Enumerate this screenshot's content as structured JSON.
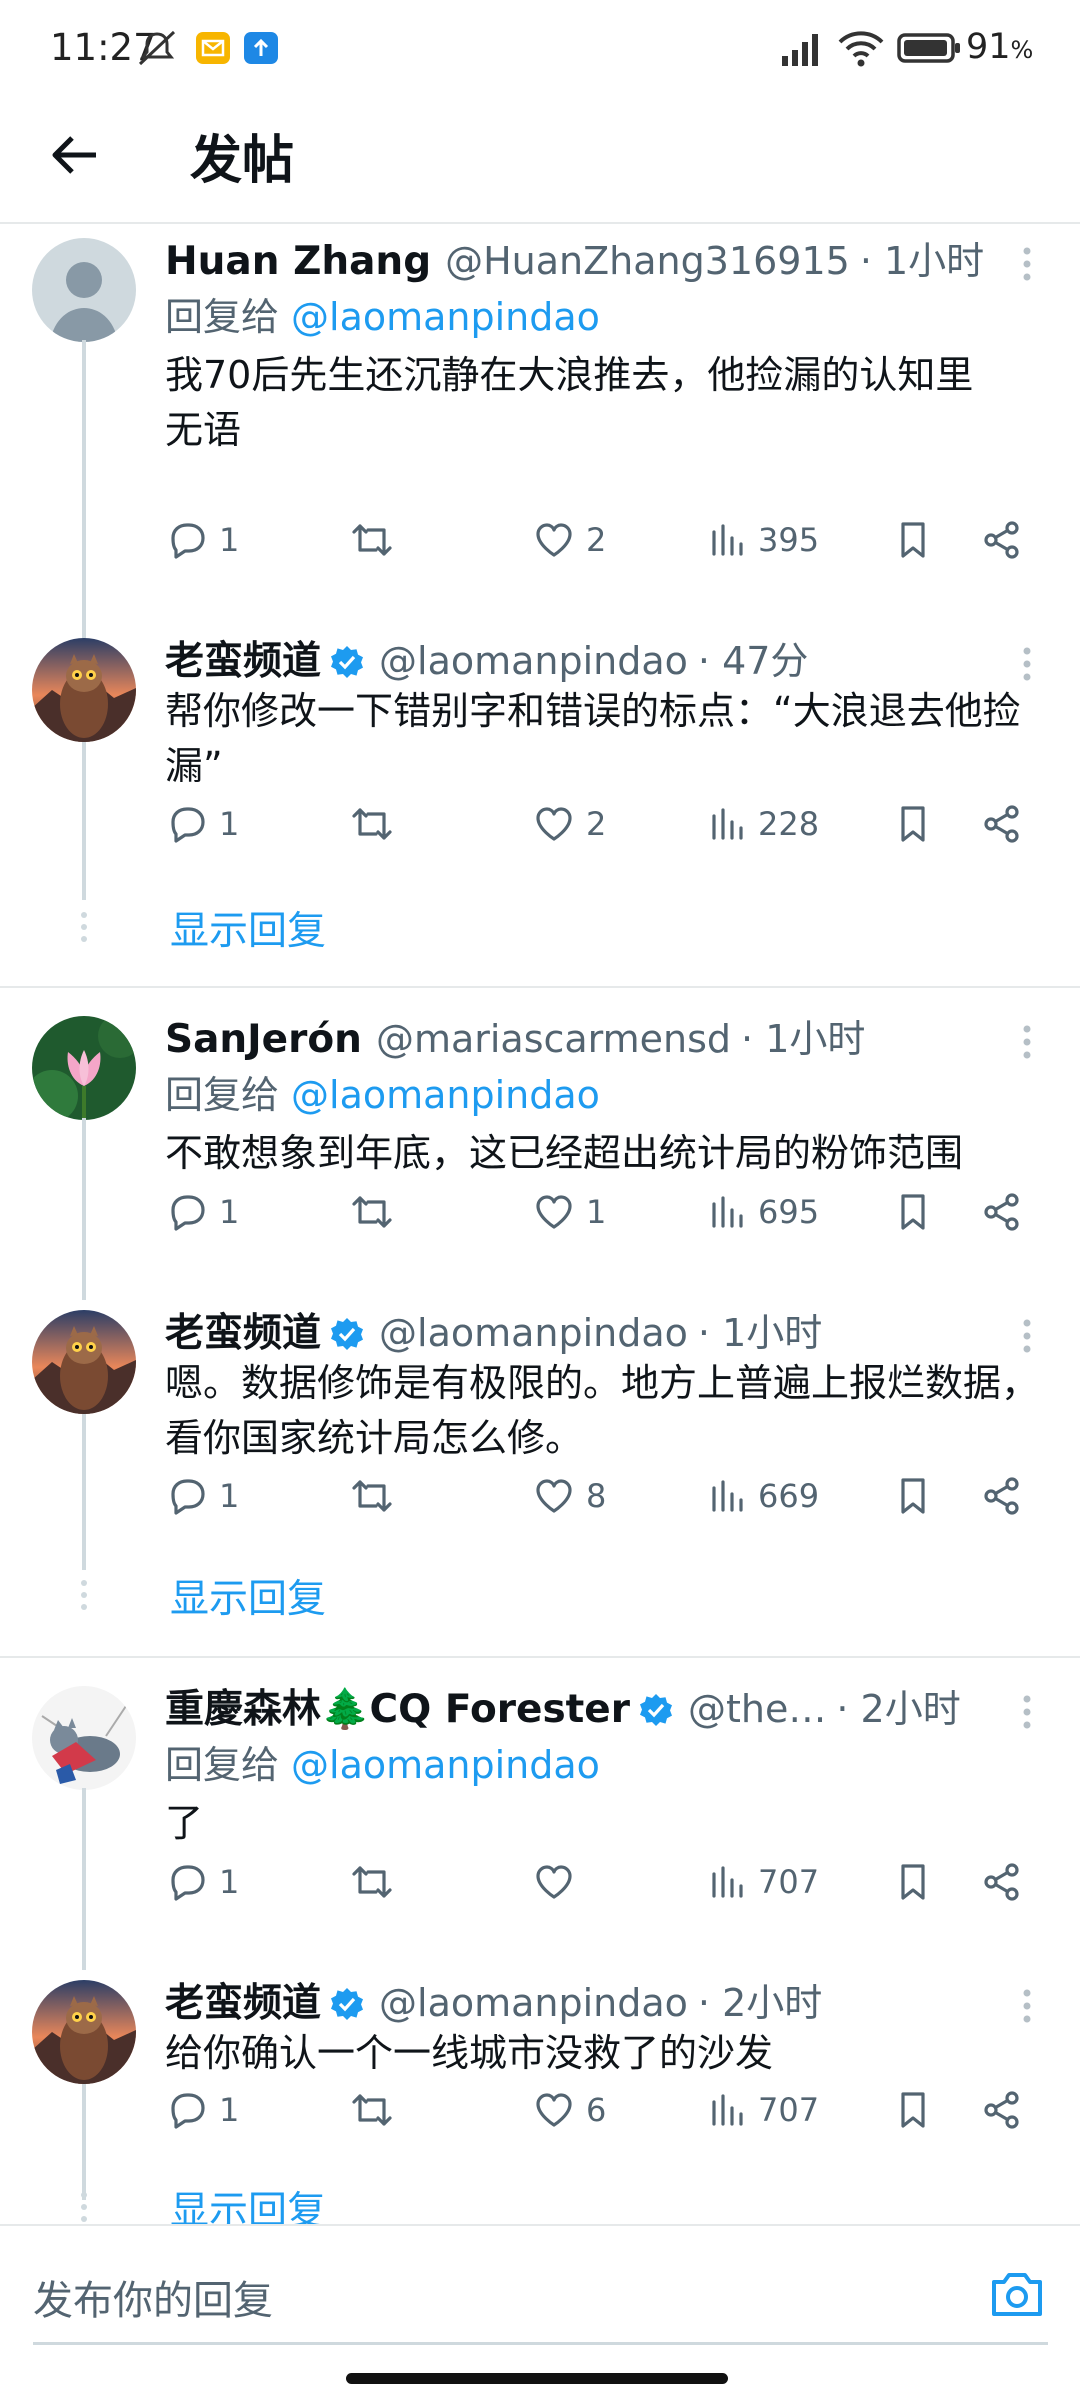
{
  "status_bar": {
    "time": "11:27",
    "battery_pct": "91",
    "battery_unit": "%",
    "icons": [
      "mute-icon",
      "mail-notification-icon",
      "upload-notification-icon",
      "signal-icon",
      "wifi-icon",
      "battery-icon"
    ]
  },
  "header": {
    "title": "发帖",
    "back_icon": "arrow-left-icon"
  },
  "colors": {
    "accent": "#1d9bf0",
    "secondary_text": "#536471",
    "primary_text": "#0f1419",
    "divider": "#e6e9ea"
  },
  "posts": [
    {
      "name": "Huan Zhang",
      "handle": "@HuanZhang316915",
      "time": "· 1小时",
      "reply_prefix": "回复给",
      "reply_to": "@laomanpindao",
      "body": "我70后先生还沉静在大浪推去，他捡漏的认知里\n无语",
      "replies": "1",
      "reposts": "",
      "likes": "2",
      "views": "395"
    },
    {
      "name": "老蛮频道",
      "verified": true,
      "handle": "@laomanpindao",
      "time": "· 47分",
      "body": "帮你修改一下错别字和错误的标点：“大浪退去他捡漏”",
      "replies": "1",
      "reposts": "",
      "likes": "2",
      "views": "228",
      "show_replies": "显示回复"
    },
    {
      "name": "SanJerón",
      "handle": "@mariascarmensd",
      "time": "· 1小时",
      "reply_prefix": "回复给",
      "reply_to": "@laomanpindao",
      "body": "不敢想象到年底，这已经超出统计局的粉饰范围",
      "replies": "1",
      "reposts": "",
      "likes": "1",
      "views": "695"
    },
    {
      "name": "老蛮频道",
      "verified": true,
      "handle": "@laomanpindao",
      "time": "· 1小时",
      "body": "嗯。数据修饰是有极限的。地方上普遍上报烂数据，看你国家统计局怎么修。",
      "replies": "1",
      "reposts": "",
      "likes": "8",
      "views": "669",
      "show_replies": "显示回复"
    },
    {
      "name": "重慶森林🌲CQ Forester",
      "verified": true,
      "handle": "@the…",
      "time": "· 2小时",
      "reply_prefix": "回复给",
      "reply_to": "@laomanpindao",
      "body": "了",
      "replies": "1",
      "reposts": "",
      "likes": "",
      "views": "707"
    },
    {
      "name": "老蛮频道",
      "verified": true,
      "handle": "@laomanpindao",
      "time": "· 2小时",
      "body": "给你确认一个一线城市没救了的沙发",
      "replies": "1",
      "reposts": "",
      "likes": "6",
      "views": "707",
      "show_replies": "显示回复"
    }
  ],
  "composer": {
    "placeholder": "发布你的回复",
    "camera_icon": "camera-icon"
  }
}
